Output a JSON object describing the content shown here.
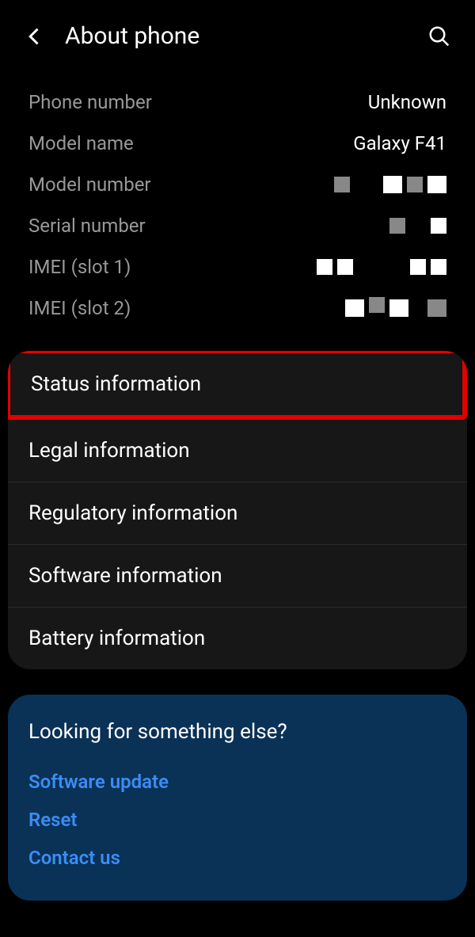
{
  "header": {
    "title": "About phone"
  },
  "info": {
    "phone_number_label": "Phone number",
    "phone_number_value": "Unknown",
    "model_name_label": "Model name",
    "model_name_value": "Galaxy F41",
    "model_number_label": "Model number",
    "serial_number_label": "Serial number",
    "imei1_label": "IMEI (slot 1)",
    "imei2_label": "IMEI (slot 2)"
  },
  "options": {
    "status_information": "Status information",
    "legal_information": "Legal information",
    "regulatory_information": "Regulatory information",
    "software_information": "Software information",
    "battery_information": "Battery information"
  },
  "suggestion": {
    "title": "Looking for something else?",
    "software_update": "Software update",
    "reset": "Reset",
    "contact_us": "Contact us"
  }
}
